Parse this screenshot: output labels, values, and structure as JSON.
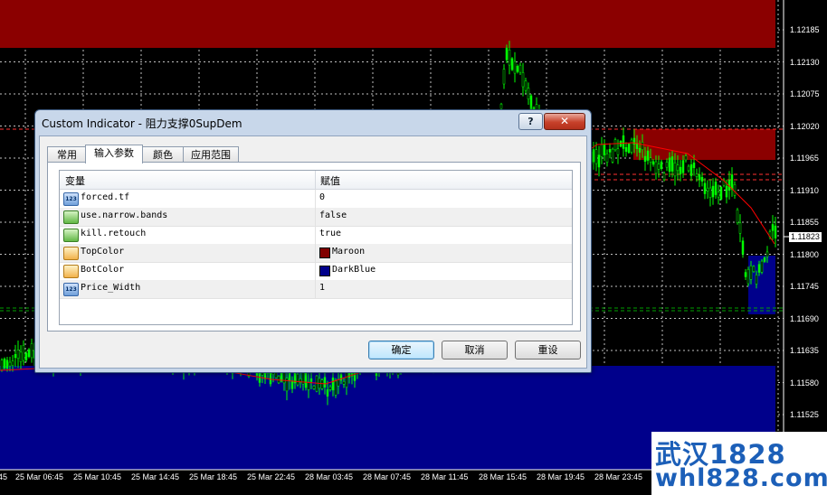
{
  "chart": {
    "price_labels": [
      "1.12185",
      "1.12130",
      "1.12075",
      "1.12020",
      "1.11965",
      "1.11910",
      "1.11855",
      "1.11800",
      "1.11745",
      "1.11690",
      "1.11635",
      "1.11580",
      "1.11525"
    ],
    "current_price": "1.11823",
    "time_labels": [
      "45",
      "25 Mar 06:45",
      "25 Mar 10:45",
      "25 Mar 14:45",
      "25 Mar 18:45",
      "25 Mar 22:45",
      "28 Mar 03:45",
      "28 Mar 07:45",
      "28 Mar 11:45",
      "28 Mar 15:45",
      "28 Mar 19:45",
      "28 Mar 23:45"
    ],
    "colors": {
      "background": "#000000",
      "grid": "#c0c0c0",
      "candle": "#00ff00",
      "ma_line": "#ff0000",
      "supply_zone": "#8b0000",
      "demand_zone": "#00008b",
      "level_line": "#ff3030",
      "support_line": "#00a000"
    }
  },
  "watermark": {
    "line1": "武汉1828",
    "line2": "whl828.com"
  },
  "dialog": {
    "title": "Custom Indicator - 阻力支撑0SupDem",
    "help_label": "?",
    "close_label": "✕",
    "tabs": [
      "常用",
      "输入参数",
      "颜色",
      "应用范围"
    ],
    "active_tab": 1,
    "grid": {
      "headers": {
        "variable": "变量",
        "value": "赋值"
      },
      "rows": [
        {
          "icon": "int-param-icon",
          "name": "forced.tf",
          "value": "0"
        },
        {
          "icon": "bool-param-icon",
          "name": "use.narrow.bands",
          "value": "false"
        },
        {
          "icon": "bool-param-icon",
          "name": "kill.retouch",
          "value": "true"
        },
        {
          "icon": "color-param-icon",
          "name": "TopColor",
          "value": "Maroon",
          "swatch": "#800000"
        },
        {
          "icon": "color-param-icon",
          "name": "BotColor",
          "value": "DarkBlue",
          "swatch": "#00008b"
        },
        {
          "icon": "int-param-icon",
          "name": "Price_Width",
          "value": "1"
        }
      ]
    },
    "buttons": {
      "ok": "确定",
      "cancel": "取消",
      "reset": "重设"
    }
  }
}
